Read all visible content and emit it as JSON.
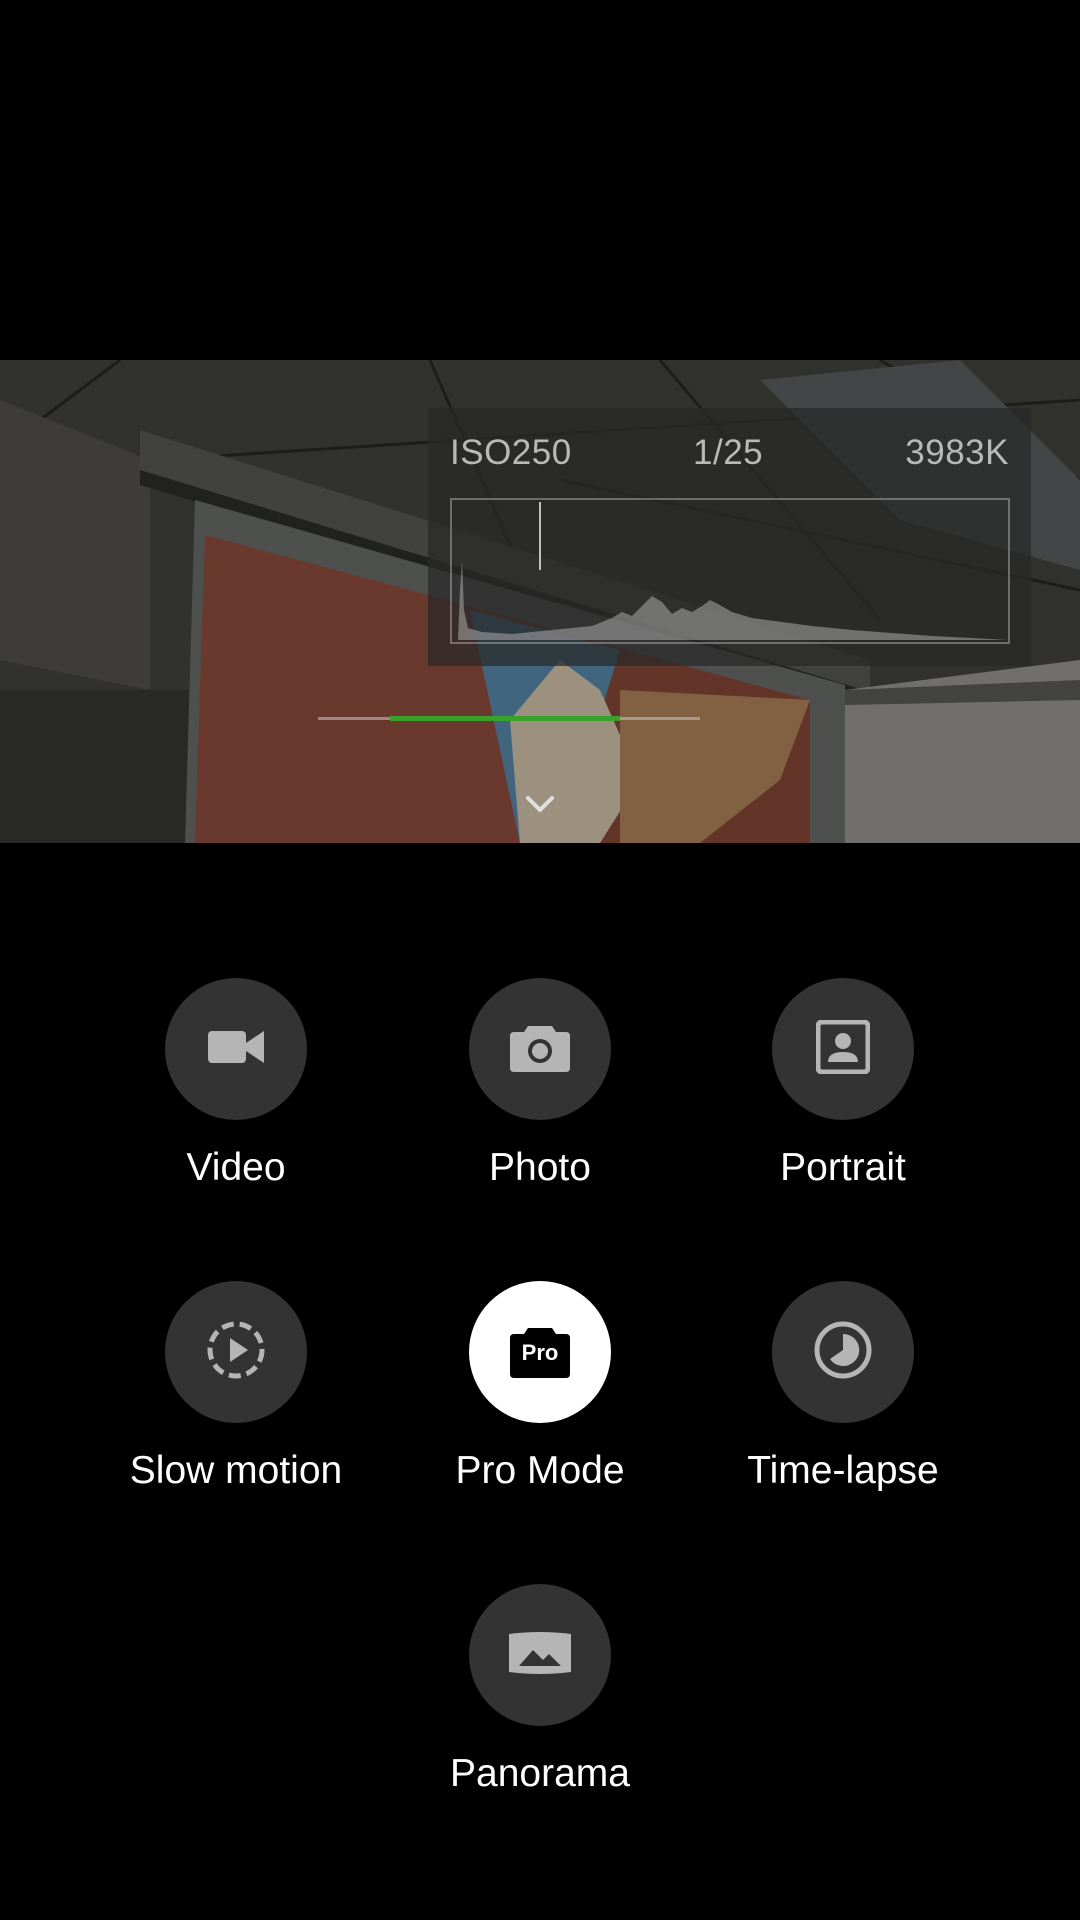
{
  "pro_panel": {
    "iso": "ISO250",
    "shutter": "1/25",
    "white_balance": "3983K"
  },
  "exposure_bar": {
    "level_fraction": 0.79,
    "accent_color": "#3aa12a"
  },
  "viewfinder": {
    "collapse_icon": "chevron-down-icon"
  },
  "modes": [
    {
      "label": "Video",
      "icon": "video-camera-icon",
      "active": false
    },
    {
      "label": "Photo",
      "icon": "camera-icon",
      "active": false
    },
    {
      "label": "Portrait",
      "icon": "portrait-icon",
      "active": false
    },
    {
      "label": "Slow motion",
      "icon": "slow-motion-icon",
      "active": false
    },
    {
      "label": "Pro Mode",
      "icon": "pro-camera-icon",
      "icon_text": "Pro",
      "active": true
    },
    {
      "label": "Time-lapse",
      "icon": "timelapse-icon",
      "active": false
    },
    {
      "label": "Panorama",
      "icon": "panorama-icon",
      "active": false
    }
  ],
  "colors": {
    "background": "#000000",
    "mode_circle": "#333333",
    "mode_circle_active": "#ffffff",
    "icon": "#b5b5b5"
  }
}
